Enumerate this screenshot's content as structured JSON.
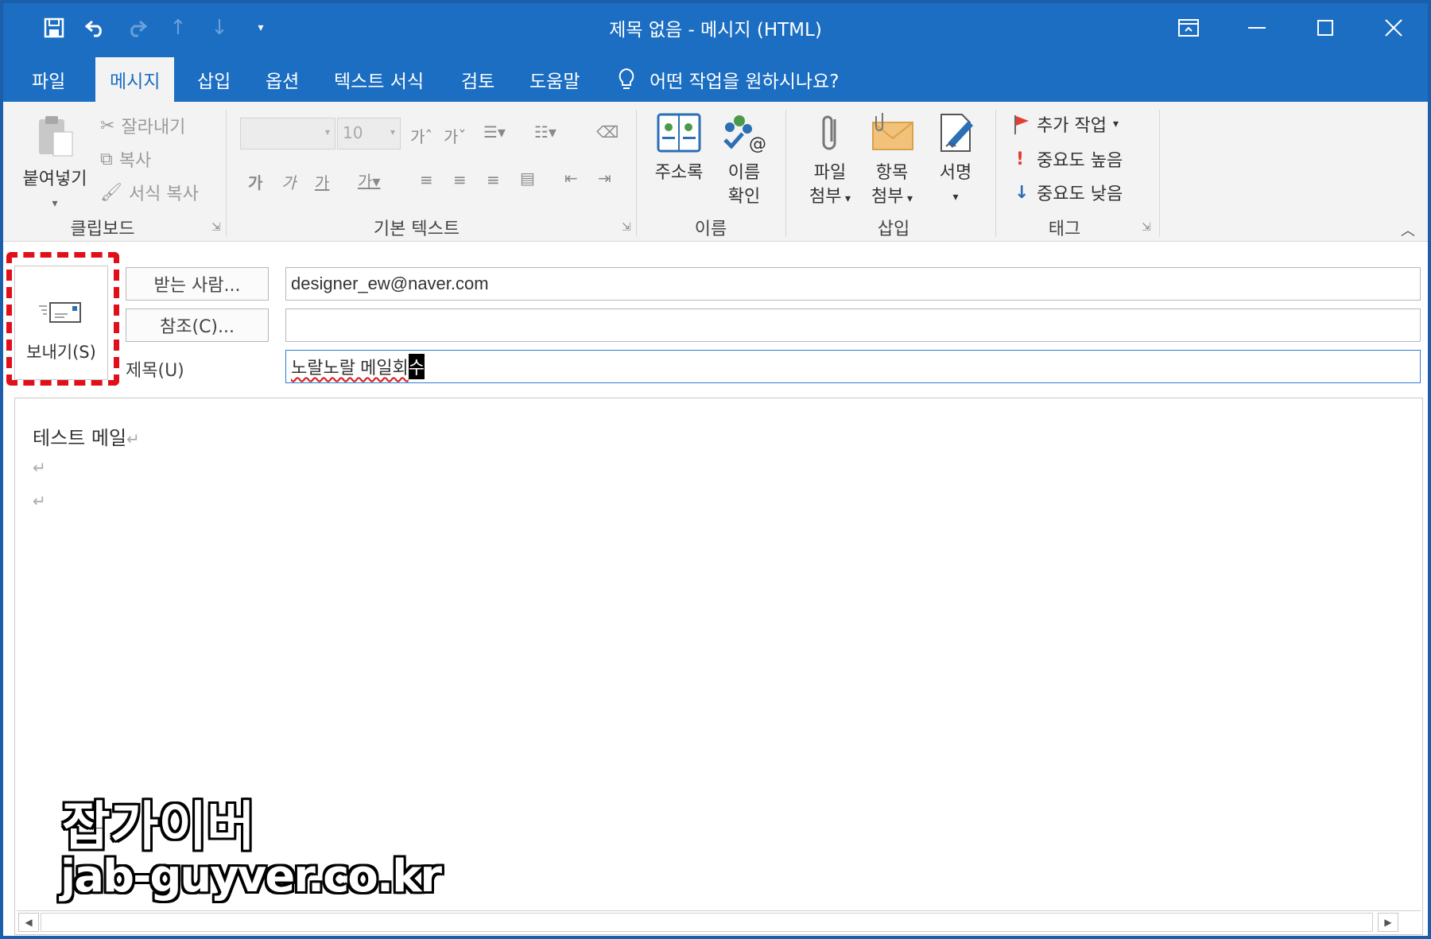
{
  "window": {
    "title": "제목 없음  -  메시지 (HTML)"
  },
  "qat": {
    "save_icon": "save-icon",
    "undo_icon": "undo-icon",
    "redo_icon": "redo-icon",
    "up_icon": "arrow-up-icon",
    "down_icon": "arrow-down-icon",
    "customize_icon": "customize-icon"
  },
  "menu": {
    "tabs": [
      "파일",
      "메시지",
      "삽입",
      "옵션",
      "텍스트 서식",
      "검토",
      "도움말"
    ],
    "active_tab": "메시지",
    "tell_me": "어떤 작업을 원하시나요?"
  },
  "ribbon": {
    "clipboard": {
      "label": "클립보드",
      "paste": "붙여넣기",
      "cut": "잘라내기",
      "copy": "복사",
      "format_painter": "서식 복사"
    },
    "basic_text": {
      "label": "기본 텍스트",
      "font_size": "10"
    },
    "names": {
      "label": "이름",
      "address_book": "주소록",
      "check_names_1": "이름",
      "check_names_2": "확인"
    },
    "insert": {
      "label": "삽입",
      "attach_file_1": "파일",
      "attach_file_2": "첨부",
      "attach_item_1": "항목",
      "attach_item_2": "첨부",
      "signature": "서명"
    },
    "tags": {
      "label": "태그",
      "follow_up": "추가 작업",
      "high_importance": "중요도 높음",
      "low_importance": "중요도 낮음"
    }
  },
  "compose": {
    "send_label": "보내기(S)",
    "to_button": "받는 사람...",
    "cc_button": "참조(C)...",
    "subject_label": "제목(U)",
    "to_value": "designer_ew@naver.com",
    "cc_value": "",
    "subject_main": "노랄노랄 메일회",
    "subject_selected": "수"
  },
  "body": {
    "line1": "테스트 메일"
  },
  "watermark": {
    "title": "잡가이버",
    "url": "jab-guyver.co.kr"
  },
  "colors": {
    "titlebar": "#1b6ec2",
    "highlight": "#e0101a"
  }
}
